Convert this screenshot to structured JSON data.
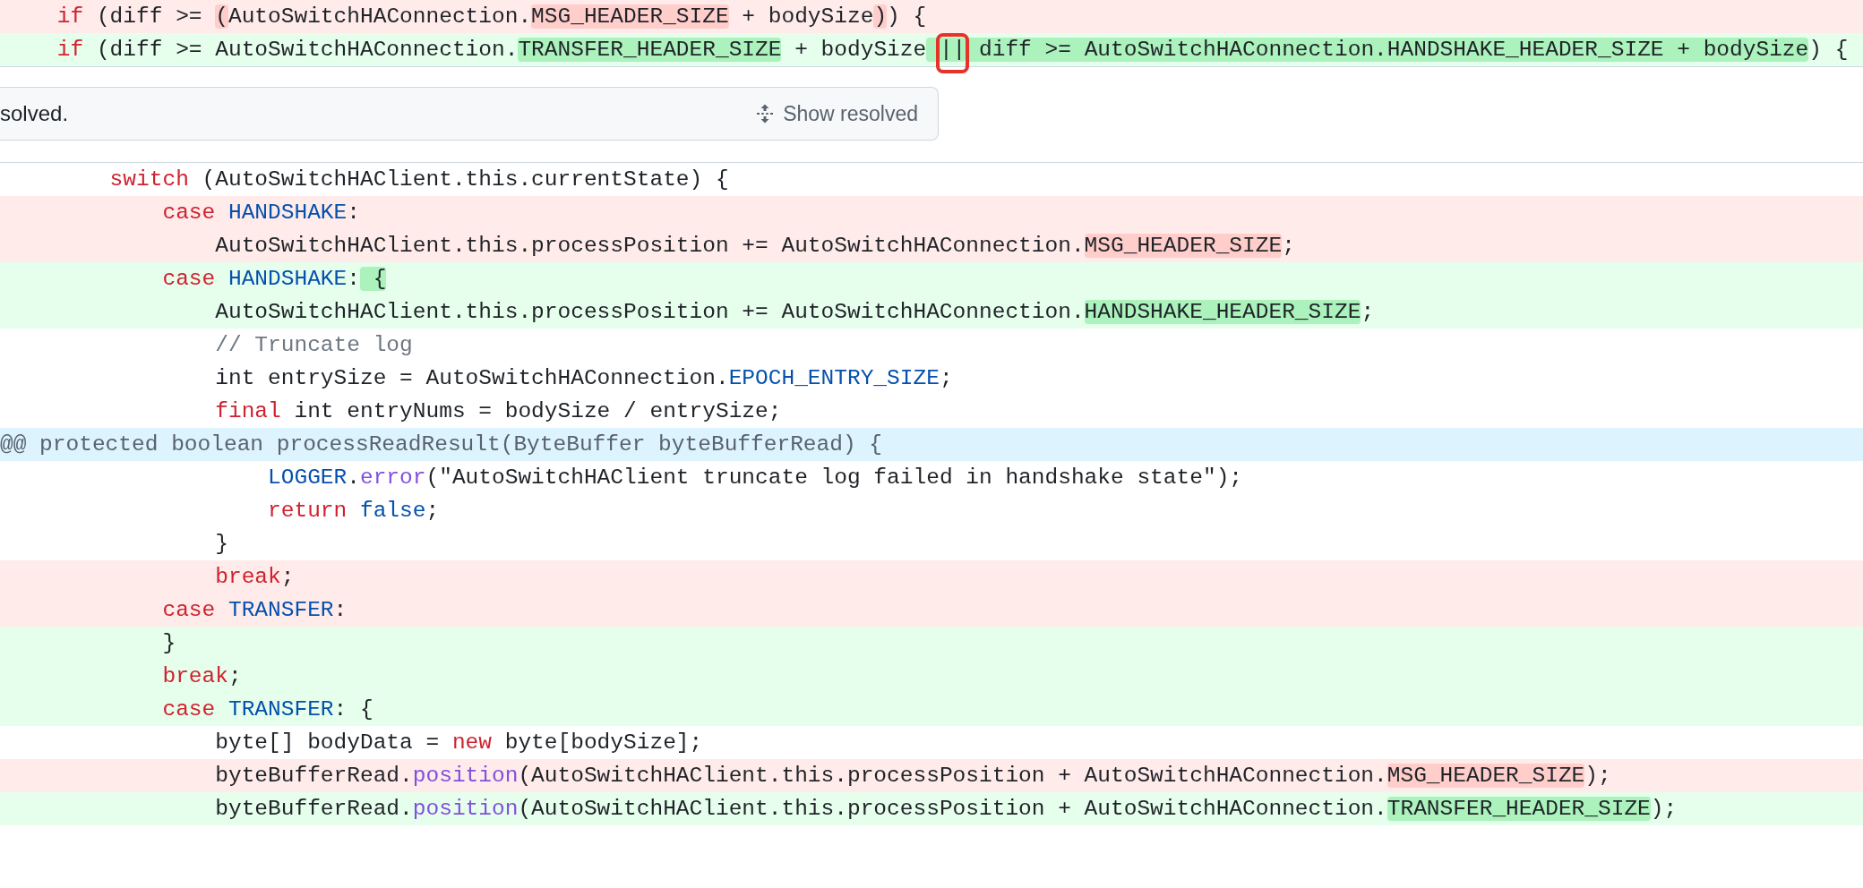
{
  "top_lines": [
    {
      "kind": "deleted",
      "segments": [
        {
          "t": "    if",
          "kind": "keyword"
        },
        {
          "t": " (diff >= "
        },
        {
          "t": "(",
          "hl": true
        },
        {
          "t": "AutoSwitchHAConnection."
        },
        {
          "t": "MSG_HEADER_SIZE",
          "hl": true
        },
        {
          "t": " + bodySize"
        },
        {
          "t": ")",
          "hl": true
        },
        {
          "t": ") {"
        }
      ]
    },
    {
      "kind": "added",
      "segments": [
        {
          "t": "    if",
          "kind": "keyword"
        },
        {
          "t": " (diff >= AutoSwitchHAConnection."
        },
        {
          "t": "TRANSFER_HEADER_SIZE",
          "hl": true
        },
        {
          "t": " + bodySize"
        },
        {
          "t": " ||",
          "hl": true,
          "boxed": true
        },
        {
          "t": " diff >= AutoSwitchHAConnection.HANDSHAKE_HEADER_SIZE + bodySize",
          "hl": true
        },
        {
          "t": ") {"
        }
      ]
    }
  ],
  "resolved_bar": {
    "message": "solved.",
    "button": "Show resolved"
  },
  "lines": [
    {
      "kind": "context",
      "segments": [
        {
          "t": "        switch",
          "kind": "keyword"
        },
        {
          "t": " (AutoSwitchHAClient.this.currentState) {"
        }
      ]
    },
    {
      "kind": "deleted",
      "segments": [
        {
          "t": "            case",
          "kind": "keyword"
        },
        {
          "t": " HANDSHAKE",
          "kind": "constant"
        },
        {
          "t": ":"
        }
      ]
    },
    {
      "kind": "deleted",
      "segments": [
        {
          "t": "                AutoSwitchHAClient.this.processPosition += AutoSwitchHAConnection."
        },
        {
          "t": "MSG_HEADER_SIZE",
          "hl": true
        },
        {
          "t": ";"
        }
      ]
    },
    {
      "kind": "added",
      "segments": [
        {
          "t": "            case",
          "kind": "keyword"
        },
        {
          "t": " HANDSHAKE",
          "kind": "constant"
        },
        {
          "t": ":"
        },
        {
          "t": " {",
          "hl": true
        }
      ]
    },
    {
      "kind": "added",
      "segments": [
        {
          "t": "                AutoSwitchHAClient.this.processPosition += AutoSwitchHAConnection."
        },
        {
          "t": "HANDSHAKE_HEADER_SIZE",
          "hl": true
        },
        {
          "t": ";"
        }
      ]
    },
    {
      "kind": "context",
      "segments": [
        {
          "t": "                // Truncate log",
          "kind": "comment"
        }
      ]
    },
    {
      "kind": "context",
      "segments": [
        {
          "t": "                int entrySize = AutoSwitchHAConnection."
        },
        {
          "t": "EPOCH_ENTRY_SIZE",
          "kind": "constant"
        },
        {
          "t": ";"
        }
      ]
    },
    {
      "kind": "context",
      "segments": [
        {
          "t": "                final",
          "kind": "keyword"
        },
        {
          "t": " int entryNums = bodySize / entrySize;"
        }
      ]
    },
    {
      "kind": "hunk",
      "segments": [
        {
          "t": "@@ protected boolean processReadResult(ByteBuffer byteBufferRead) {"
        }
      ]
    },
    {
      "kind": "context",
      "segments": [
        {
          "t": "                    LOGGER",
          "kind": "constant"
        },
        {
          "t": "."
        },
        {
          "t": "error",
          "kind": "function"
        },
        {
          "t": "(\"AutoSwitchHAClient truncate log failed in handshake state\");"
        }
      ]
    },
    {
      "kind": "context",
      "segments": [
        {
          "t": "                    return",
          "kind": "keyword"
        },
        {
          "t": " false",
          "kind": "constant"
        },
        {
          "t": ";"
        }
      ]
    },
    {
      "kind": "context",
      "segments": [
        {
          "t": "                }"
        }
      ]
    },
    {
      "kind": "deleted",
      "segments": [
        {
          "t": "                break",
          "kind": "keyword"
        },
        {
          "t": ";"
        }
      ]
    },
    {
      "kind": "deleted",
      "segments": [
        {
          "t": "            case",
          "kind": "keyword"
        },
        {
          "t": " TRANSFER",
          "kind": "constant"
        },
        {
          "t": ":"
        }
      ]
    },
    {
      "kind": "added",
      "segments": [
        {
          "t": "            }"
        }
      ]
    },
    {
      "kind": "added",
      "segments": [
        {
          "t": "            break",
          "kind": "keyword"
        },
        {
          "t": ";"
        }
      ]
    },
    {
      "kind": "added",
      "segments": [
        {
          "t": "            case",
          "kind": "keyword"
        },
        {
          "t": " TRANSFER",
          "kind": "constant"
        },
        {
          "t": ": {"
        }
      ]
    },
    {
      "kind": "context",
      "segments": [
        {
          "t": "                byte[] bodyData = "
        },
        {
          "t": "new",
          "kind": "keyword"
        },
        {
          "t": " byte[bodySize];"
        }
      ]
    },
    {
      "kind": "deleted",
      "segments": [
        {
          "t": "                byteBufferRead."
        },
        {
          "t": "position",
          "kind": "function"
        },
        {
          "t": "(AutoSwitchHAClient.this.processPosition + AutoSwitchHAConnection."
        },
        {
          "t": "MSG_HEADER_SIZE",
          "hl": true
        },
        {
          "t": ");"
        }
      ]
    },
    {
      "kind": "added",
      "segments": [
        {
          "t": "                byteBufferRead."
        },
        {
          "t": "position",
          "kind": "function"
        },
        {
          "t": "(AutoSwitchHAClient.this.processPosition + AutoSwitchHAConnection."
        },
        {
          "t": "TRANSFER_HEADER_SIZE",
          "hl": true
        },
        {
          "t": ");"
        }
      ]
    }
  ]
}
